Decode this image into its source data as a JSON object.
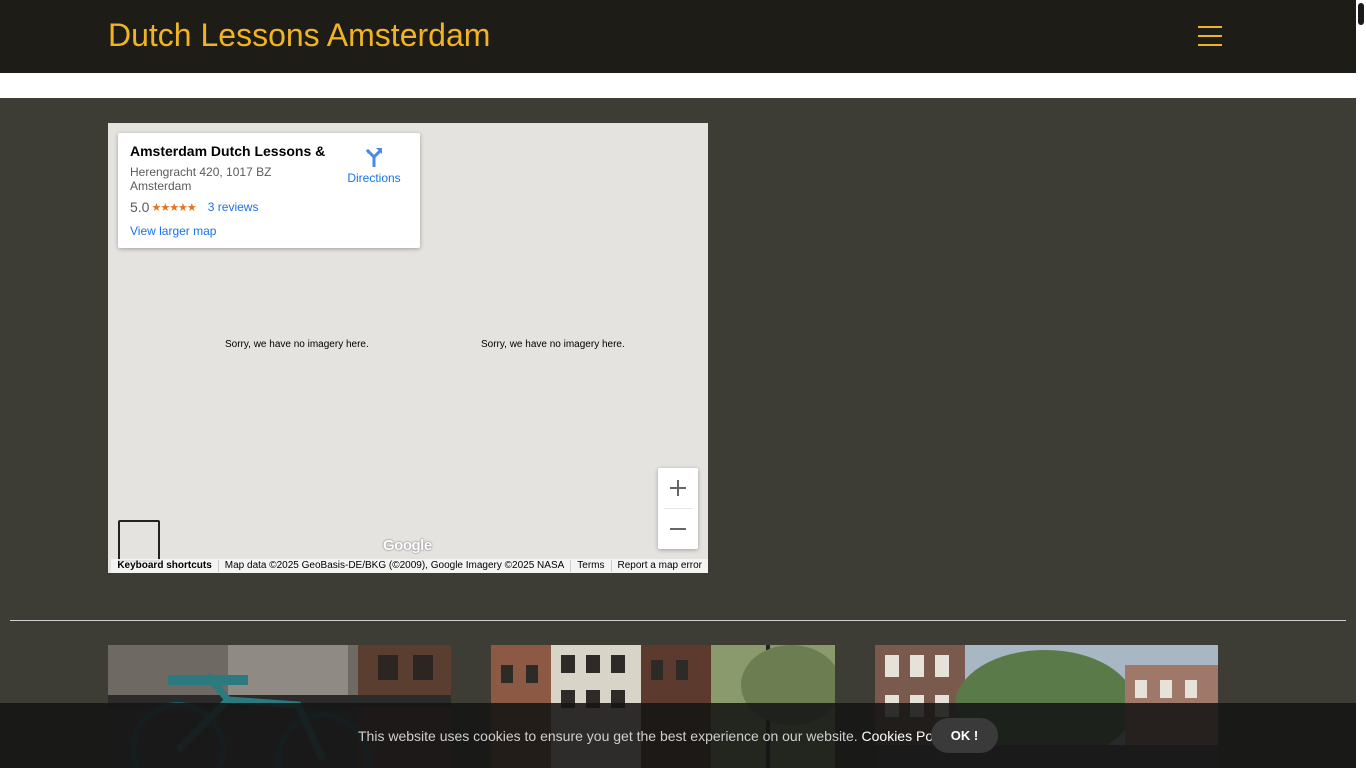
{
  "header": {
    "brand": "Dutch Lessons Amsterdam",
    "menu_icon": "hamburger-menu-icon",
    "brand_color": "#f0b323",
    "background": "#1e1c16"
  },
  "map": {
    "place_name": "Amsterdam Dutch Lessons & ...",
    "address": "Herengracht 420, 1017 BZ Amsterdam",
    "rating": "5.0",
    "stars": "★★★★★",
    "reviews_link": "3 reviews",
    "directions_label": "Directions",
    "view_larger": "View larger map",
    "no_imagery_left": "Sorry, we have no imagery here.",
    "no_imagery_right": "Sorry, we have no imagery here.",
    "google_logo": "Google",
    "attribution": {
      "shortcuts": "Keyboard shortcuts",
      "map_data": "Map data ©2025 GeoBasis-DE/BKG (©2009), Google Imagery ©2025 NASA",
      "terms": "Terms",
      "report": "Report a map error"
    }
  },
  "gallery": {
    "images": [
      "bicycle-by-canal-photo",
      "canal-houses-photo",
      "canal-street-photo"
    ]
  },
  "cookie": {
    "text": "This website uses cookies to ensure you get the best experience on our website.",
    "policy_link": "Cookies Policy",
    "period": ".",
    "ok_button": "OK !"
  }
}
